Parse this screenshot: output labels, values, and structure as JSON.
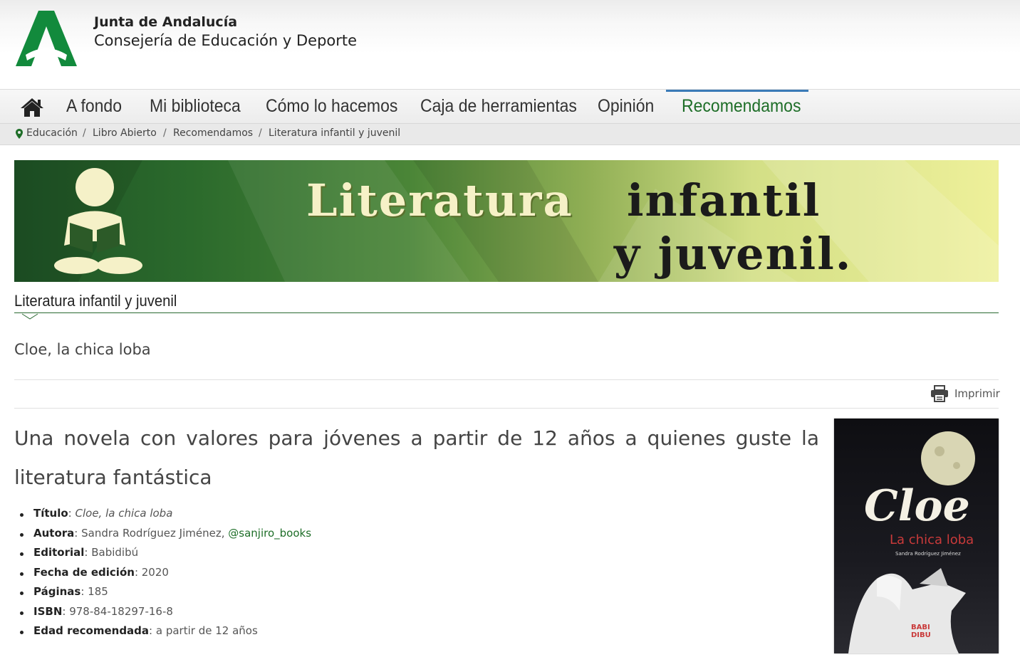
{
  "header": {
    "org_name": "Junta de Andalucía",
    "department": "Consejería de Educación y Deporte"
  },
  "nav": {
    "items": [
      {
        "label": "A fondo"
      },
      {
        "label": "Mi biblioteca"
      },
      {
        "label": "Cómo lo hacemos"
      },
      {
        "label": "Caja de herramientas"
      },
      {
        "label": "Opinión"
      },
      {
        "label": "Recomendamos",
        "active": true
      }
    ],
    "home_icon": "home-icon"
  },
  "breadcrumb": [
    "Educación",
    "Libro Abierto",
    "Recomendamos",
    "Literatura infantil y juvenil"
  ],
  "banner": {
    "line1_a": "Literatura",
    "line1_b": "infantil",
    "line2": "y juvenil."
  },
  "section": {
    "title": "Literatura infantil y juvenil"
  },
  "article": {
    "title": "Cloe, la chica loba",
    "print_label": "Imprimir",
    "headline": "Una novela con valores para jóvenes a partir de 12 años a quienes guste la literatura fantástica",
    "details": [
      {
        "label": "Título",
        "value": "Cloe, la chica loba"
      },
      {
        "label": "Autora",
        "value": "Sandra Rodríguez Jiménez,",
        "link": "@sanjiro_books"
      },
      {
        "label": "Editorial",
        "value": "Babidibú"
      },
      {
        "label": "Fecha de edición",
        "value": "2020"
      },
      {
        "label": "Páginas",
        "value": "185"
      },
      {
        "label": "ISBN",
        "value": "978-84-18297-16-8"
      },
      {
        "label": "Edad recomendada",
        "value": "a partir de 12 años"
      }
    ]
  },
  "cover": {
    "title": "Cloe",
    "subtitle": "La chica loba",
    "author": "Sandra Rodríguez Jiménez",
    "publisher_logo": "BABI DIBU"
  },
  "colors": {
    "brand_green": "#1e6e28",
    "active_tab_bar": "#3a7bb7"
  }
}
